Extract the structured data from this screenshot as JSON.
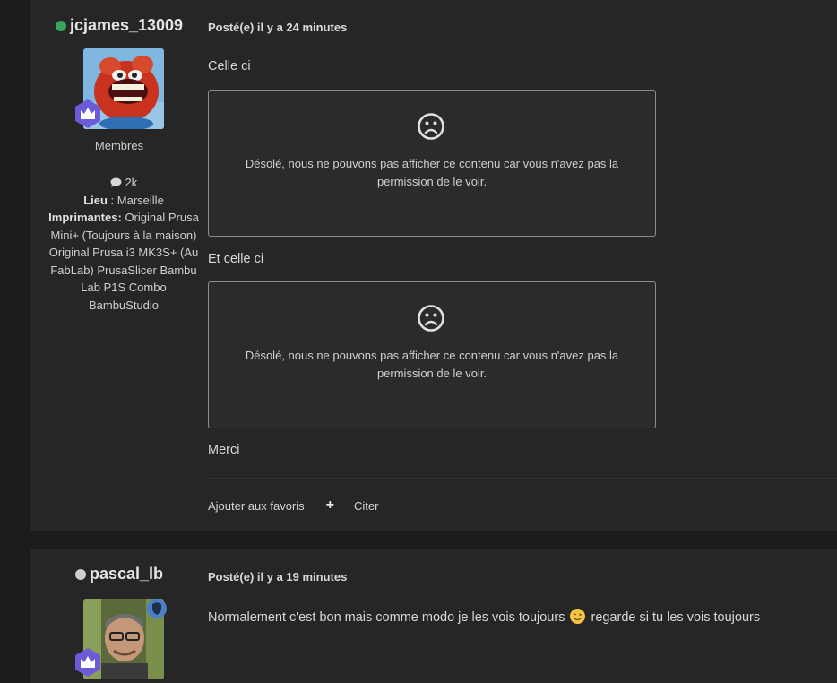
{
  "posts": [
    {
      "author": {
        "username": "jcjames_13009",
        "online_color": "#3aa55d",
        "group": "Membres",
        "post_count": "2k",
        "location_label": "Lieu",
        "location_value": "Marseille",
        "printers_label": "Imprimantes:",
        "printers_value": "Original Prusa Mini+ (Toujours à la maison) Original Prusa i3 MK3S+ (Au FabLab) PrusaSlicer Bambu Lab P1S Combo BambuStudio"
      },
      "meta": "Posté(e) il y a 24 minutes",
      "paragraph1": "Celle ci",
      "restricted_message": "Désolé, nous ne pouvons pas afficher ce contenu car vous n'avez pas la permission de le voir.",
      "paragraph2": "Et celle ci",
      "paragraph3": "Merci",
      "actions": {
        "favorite": "Ajouter aux favoris",
        "quote": "Citer"
      }
    },
    {
      "author": {
        "username": "pascal_lb",
        "online_color": "#cfcfcf"
      },
      "meta": "Posté(e) il y a 19 minutes",
      "text_before_emoji": "Normalement c'est bon mais comme modo je les vois toujours",
      "text_after_emoji": "regarde si tu les vois toujours"
    }
  ],
  "colors": {
    "accent_purple": "#6b5bd6",
    "moderator_blue": "#4a7ec9"
  }
}
